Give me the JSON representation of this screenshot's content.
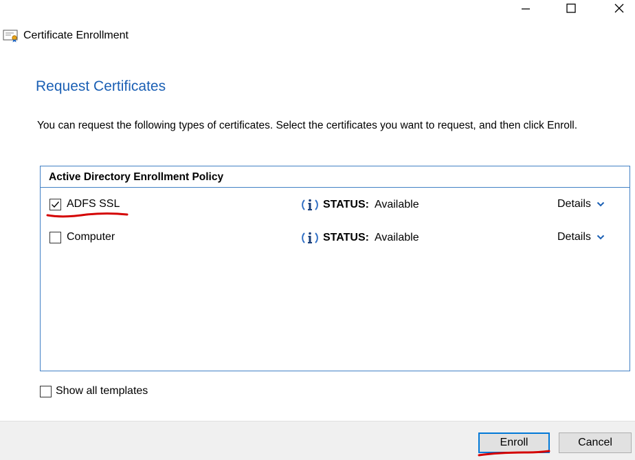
{
  "window": {
    "title": "Certificate Enrollment",
    "controls": [
      "minimize-icon",
      "maximize-icon",
      "close-icon"
    ]
  },
  "page": {
    "heading": "Request Certificates",
    "description": "You can request the following types of certificates. Select the certificates you want to request, and then click Enroll."
  },
  "policy": {
    "header": "Active Directory Enrollment Policy",
    "certificates": [
      {
        "name": "ADFS SSL",
        "checked": true,
        "status_label": "STATUS:",
        "status_value": "Available",
        "details_label": "Details"
      },
      {
        "name": "Computer",
        "checked": false,
        "status_label": "STATUS:",
        "status_value": "Available",
        "details_label": "Details"
      }
    ]
  },
  "options": {
    "show_all_templates": "Show all templates",
    "show_all_checked": false
  },
  "buttons": {
    "enroll": "Enroll",
    "cancel": "Cancel"
  },
  "colors": {
    "heading": "#1a5fb4",
    "border": "#3f7fc4",
    "annotation": "#d40000",
    "primary_border": "#0078d7"
  }
}
